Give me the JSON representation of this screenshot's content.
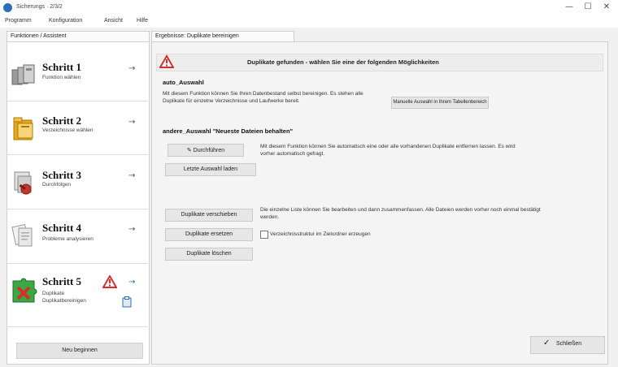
{
  "window": {
    "title": "Sicherungs · 2/3/2",
    "minimize": "—",
    "maximize": "☐",
    "close": "✕"
  },
  "menu": [
    "Programm",
    "Konfiguration",
    "Ansicht",
    "Hilfe"
  ],
  "left_panel": {
    "tab_label": "Funktionen / Assistent",
    "steps": [
      {
        "title": "Schritt 1",
        "subtitle": "Funktion wählen",
        "icon": "disks-icon",
        "arrow": "→"
      },
      {
        "title": "Schritt 2",
        "subtitle": "Verzeichnisse wählen",
        "icon": "folder-icon",
        "arrow": "→"
      },
      {
        "title": "Schritt 3",
        "subtitle": "Durchfolgen",
        "icon": "tools-icon",
        "arrow": "→"
      },
      {
        "title": "Schritt 4",
        "subtitle": "Probleme analysieren",
        "icon": "documents-icon",
        "arrow": "→"
      },
      {
        "title": "Schritt 5",
        "subtitle": "Duplikate",
        "subtitle2": "Duplikatbereinigen",
        "icon": "puzzle-icon",
        "arrow": "→"
      }
    ],
    "start_button": "Neu beginnen"
  },
  "right_panel": {
    "tab_label": "Ergebnisse: Duplikate bereinigen",
    "warning": "Duplikate gefunden - wählen Sie eine der folgenden Möglichkeiten",
    "section1": {
      "heading": "auto_Auswahl",
      "description": "Mit diesem Funktion können Sie Ihren Datenbestand selbst bereinigen. Es stehen alle Duplikate für einzelne Verzeichnisse und Laufwerke bereit.",
      "button": "Manuelle Auswahl in Ihrem Tabellenbereich"
    },
    "section2": {
      "heading": "andere_Auswahl \"Neueste Dateien behalten\"",
      "button_primary": "Durchführen",
      "button_secondary": "Letzte Auswahl laden",
      "description": "Mit diesem Funktion können Sie automatisch eine oder alle vorhandenen Duplikate entfernen lassen. Es wird vorher automatisch gefragt."
    },
    "section3": {
      "button1": "Duplikate verschieben",
      "button2": "Duplikate ersetzen",
      "button3": "Duplikate löschen",
      "description": "Die einzelne Liste können Sie bearbeiten und dann zusammenfassen. Alle Dateien werden vorher noch einmal bestätigt werden.",
      "checkbox_label": "Verzeichnisstruktur im Zielordner erzeugen"
    },
    "finish_button": "Schließen"
  },
  "colors": {
    "warning_red": "#d32f2f",
    "accent_blue": "#2a6fb8",
    "folder_gold": "#e6a817"
  }
}
